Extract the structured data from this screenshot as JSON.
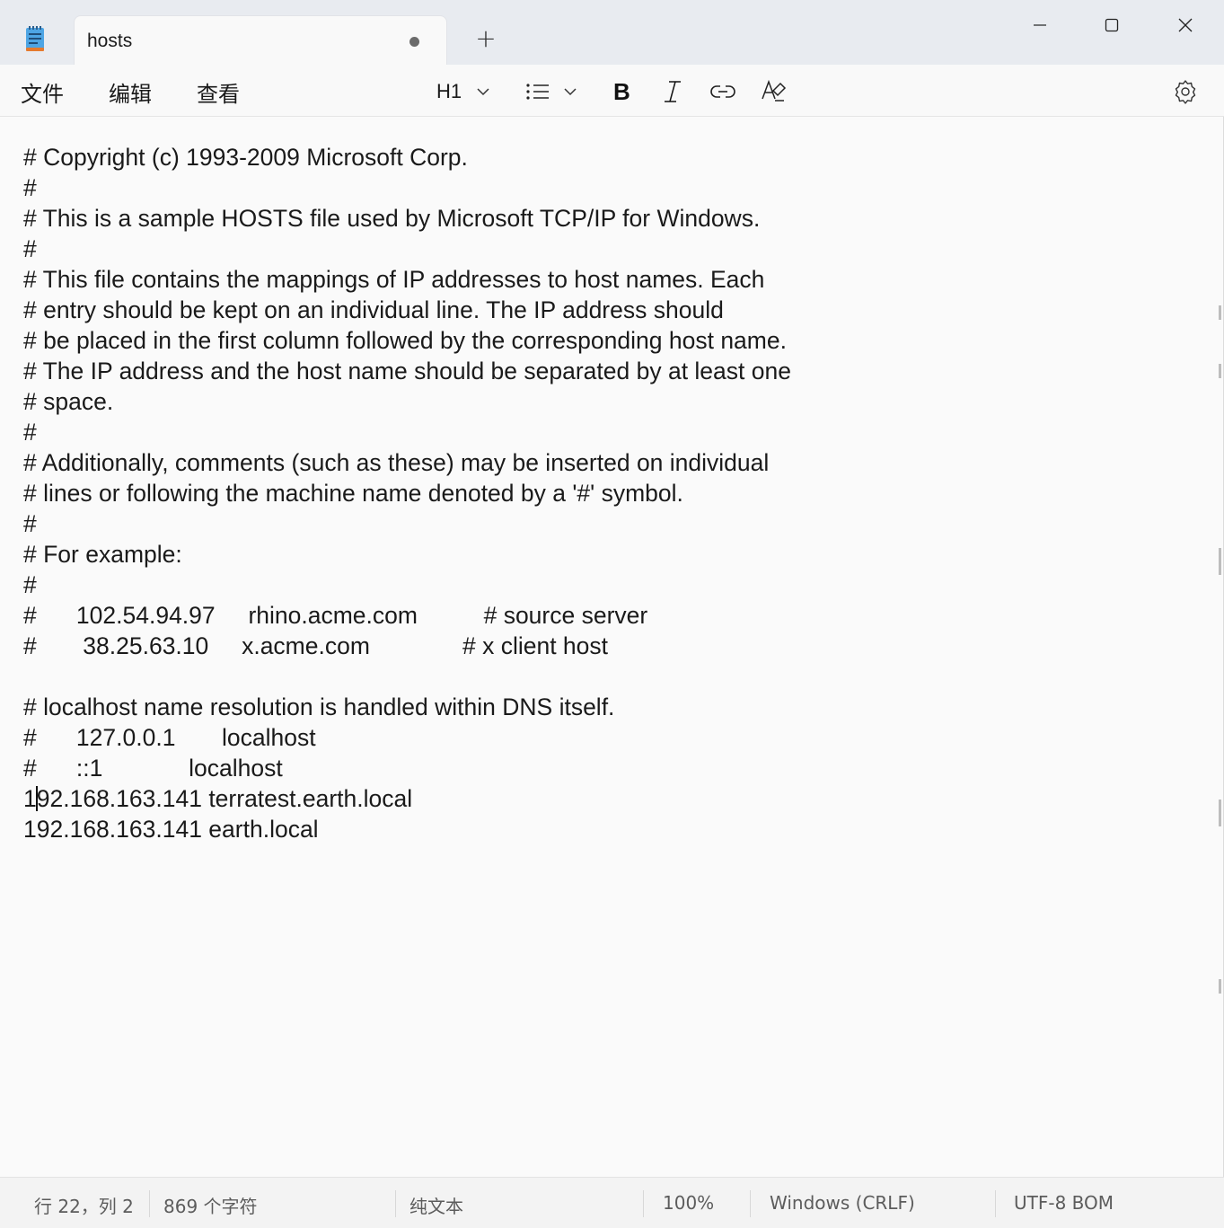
{
  "tab": {
    "title": "hosts",
    "unsaved_indicator": "unsaved-dot"
  },
  "new_tab_label": "+",
  "menu": {
    "file": "文件",
    "edit": "编辑",
    "view": "查看"
  },
  "format_toolbar": {
    "heading_label": "H1",
    "icons": [
      "list-icon",
      "bold-icon",
      "italic-icon",
      "link-icon",
      "clear-format-icon",
      "settings-icon"
    ]
  },
  "window_controls": [
    "minimize-icon",
    "maximize-icon",
    "close-icon"
  ],
  "editor": {
    "lines": [
      "# Copyright (c) 1993-2009 Microsoft Corp.",
      "#",
      "# This is a sample HOSTS file used by Microsoft TCP/IP for Windows.",
      "#",
      "# This file contains the mappings of IP addresses to host names. Each",
      "# entry should be kept on an individual line. The IP address should",
      "# be placed in the first column followed by the corresponding host name.",
      "# The IP address and the host name should be separated by at least one",
      "# space.",
      "#",
      "# Additionally, comments (such as these) may be inserted on individual",
      "# lines or following the machine name denoted by a '#' symbol.",
      "#",
      "# For example:",
      "#",
      "#      102.54.94.97     rhino.acme.com          # source server",
      "#       38.25.63.10     x.acme.com              # x client host",
      "",
      "# localhost name resolution is handled within DNS itself.",
      "#      127.0.0.1       localhost",
      "#      ::1             localhost",
      "192.168.163.141 terratest.earth.local",
      "192.168.163.141 earth.local"
    ],
    "caret_line": 22,
    "caret_column": 2
  },
  "status": {
    "position": "行 22，列 2",
    "char_count": "869 个字符",
    "format": "纯文本",
    "zoom": "100%",
    "line_ending": "Windows (CRLF)",
    "encoding": "UTF-8 BOM"
  },
  "colors": {
    "titlebar_bg": "#e8ebf0",
    "editor_bg": "#fafafa",
    "app_icon_blue": "#3b82c4",
    "app_icon_orange": "#e57a2e"
  }
}
